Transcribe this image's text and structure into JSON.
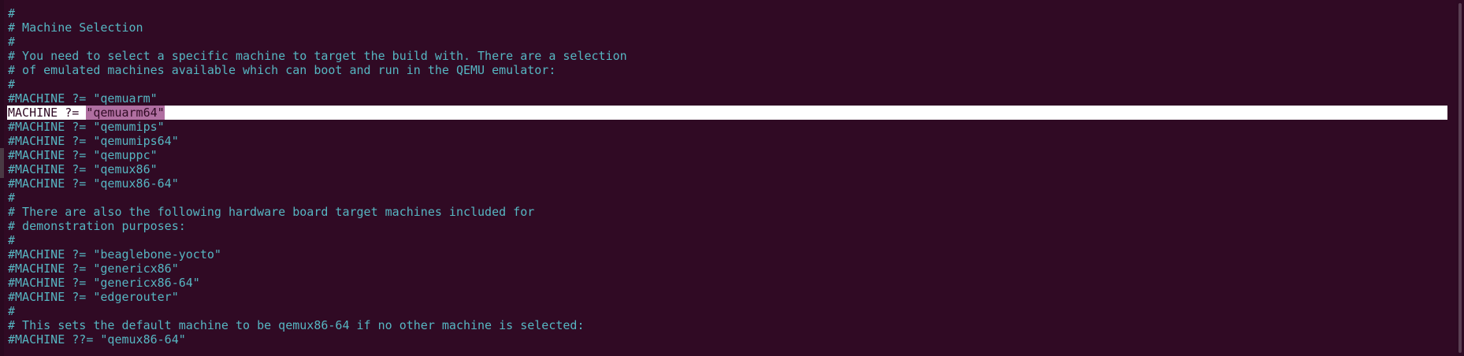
{
  "editor": {
    "lines": [
      "#",
      "# Machine Selection",
      "#",
      "# You need to select a specific machine to target the build with. There are a selection",
      "# of emulated machines available which can boot and run in the QEMU emulator:",
      "#",
      "#MACHINE ?= \"qemuarm\"",
      "MACHINE ?= ",
      "#MACHINE ?= \"qemumips\"",
      "#MACHINE ?= \"qemumips64\"",
      "#MACHINE ?= \"qemuppc\"",
      "#MACHINE ?= \"qemux86\"",
      "#MACHINE ?= \"qemux86-64\"",
      "#",
      "# There are also the following hardware board target machines included for",
      "# demonstration purposes:",
      "#",
      "#MACHINE ?= \"beaglebone-yocto\"",
      "#MACHINE ?= \"genericx86\"",
      "#MACHINE ?= \"genericx86-64\"",
      "#MACHINE ?= \"edgerouter\"",
      "#",
      "# This sets the default machine to be qemux86-64 if no other machine is selected:",
      "#MACHINE ??= \"qemux86-64\""
    ],
    "current_line_selection": "\"qemuarm64\""
  },
  "colors": {
    "background": "#300a24",
    "text": "#56b6c2",
    "cursor_line": "#ffffff",
    "selection": "#b06fa1"
  }
}
